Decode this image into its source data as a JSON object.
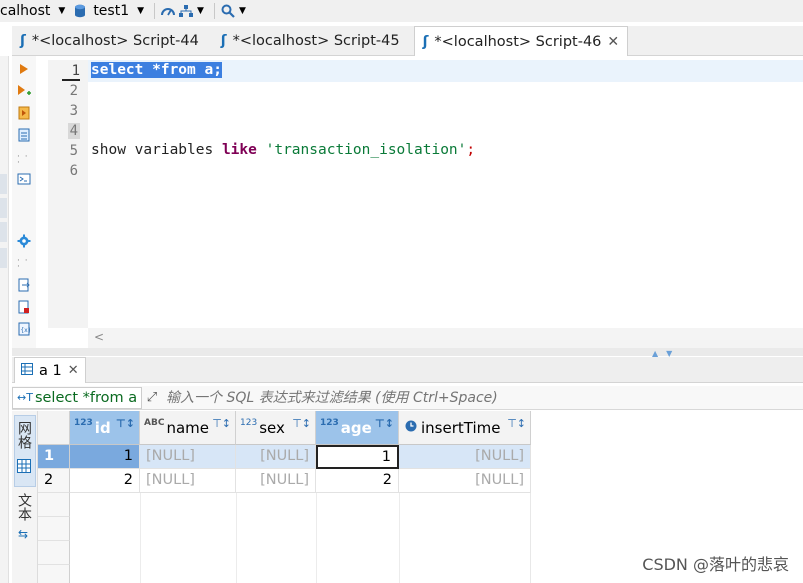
{
  "toolbar": {
    "connection": "calhost",
    "database": "test1"
  },
  "editor_tabs": [
    {
      "label": "*<localhost> Script-44"
    },
    {
      "label": "*<localhost> Script-45"
    },
    {
      "label": "*<localhost> Script-46"
    }
  ],
  "editor": {
    "line_numbers": [
      "1",
      "2",
      "3",
      "4",
      "5",
      "6"
    ],
    "line1": "select *from a;",
    "line5_a": "show variables ",
    "line5_kw": "like",
    "line5_str": "'transaction_isolation'",
    "line5_end": ";"
  },
  "results": {
    "tab_label": "a 1",
    "query_text": "select *from a",
    "filter_placeholder": "输入一个 SQL 表达式来过滤结果 (使用 Ctrl+Space)",
    "side_grid_label": "网格",
    "side_text_label": "文本",
    "columns": [
      {
        "name": "id",
        "type_icon": "123"
      },
      {
        "name": "name",
        "type_icon": "ABC"
      },
      {
        "name": "sex",
        "type_icon": "123"
      },
      {
        "name": "age",
        "type_icon": "123"
      },
      {
        "name": "insertTime",
        "type_icon": "clock"
      }
    ],
    "rows": [
      {
        "num": "1",
        "id": "1",
        "name": "[NULL]",
        "sex": "[NULL]",
        "age": "1",
        "insertTime": "[NULL]"
      },
      {
        "num": "2",
        "id": "2",
        "name": "[NULL]",
        "sex": "[NULL]",
        "age": "2",
        "insertTime": "[NULL]"
      }
    ]
  },
  "watermark": "CSDN @落叶的悲哀",
  "colors": {
    "selection": "#3c7fe0",
    "keyword": "#7f0055",
    "string": "#0a7a38",
    "header_selected": "#9cc3ea",
    "null_text": "#aaaaaa"
  }
}
